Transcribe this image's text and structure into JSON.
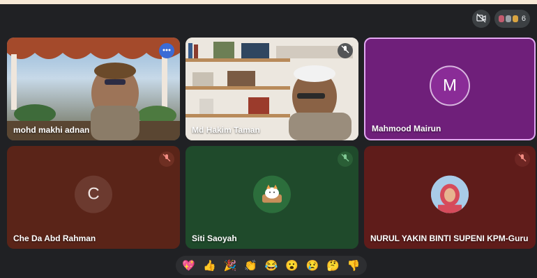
{
  "top_controls": {
    "participant_count": "6"
  },
  "tiles": [
    {
      "name": "mohd makhi adnan"
    },
    {
      "name": "Md Hakim Taman"
    },
    {
      "name": "Mahmood Mairun",
      "initial": "M"
    },
    {
      "name": "Che Da Abd Rahman",
      "initial": "C"
    },
    {
      "name": "Siti Saoyah"
    },
    {
      "name": "NURUL YAKIN BINTI SUPENI KPM-Guru"
    }
  ],
  "reactions": [
    "💖",
    "👍",
    "🎉",
    "👏",
    "😂",
    "😮",
    "😢",
    "🤔",
    "👎"
  ],
  "colors": {
    "background": "#202124",
    "tile_purple": "#6f1f7a",
    "tile_brown": "#5a2418",
    "tile_green": "#1f4a2b",
    "tile_red": "#5f1c1a",
    "active_border": "#e3a8f2"
  },
  "icons": {
    "top_left": "camera-off-icon",
    "mic_off": "mic-off-icon",
    "speaking": "audio-level-icon"
  }
}
